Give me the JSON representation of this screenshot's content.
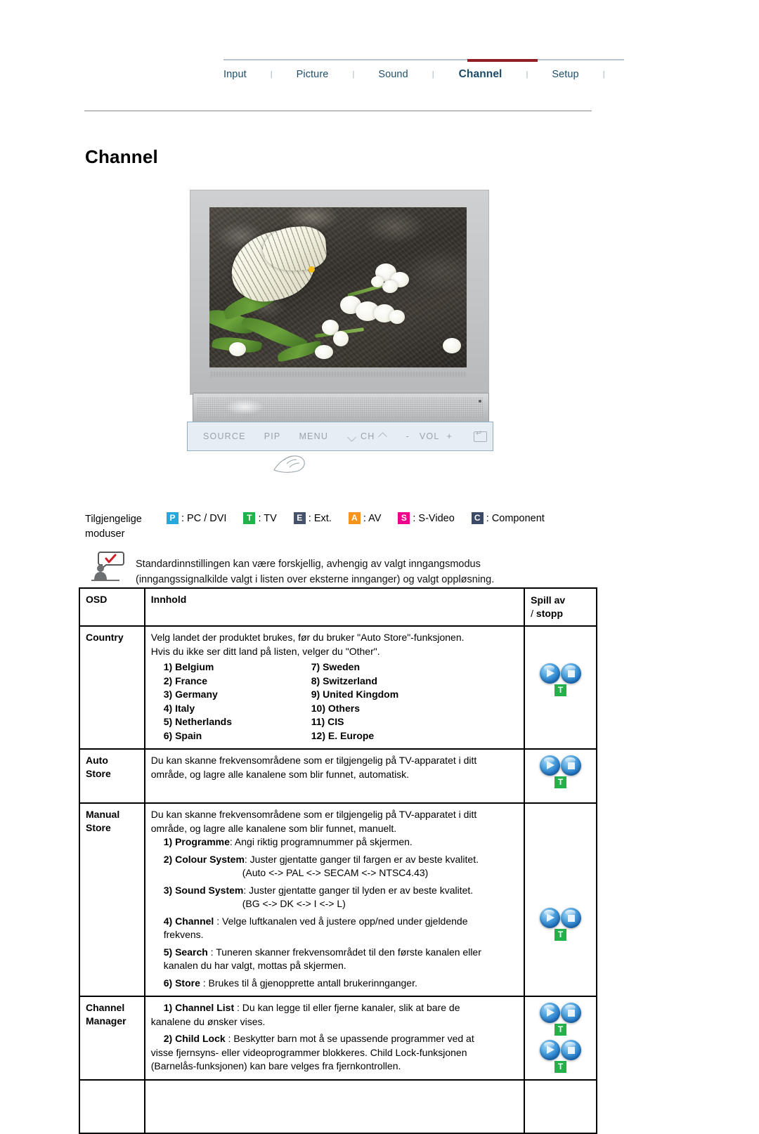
{
  "nav": {
    "tabs": [
      {
        "label": "Input",
        "active": false
      },
      {
        "label": "Picture",
        "active": false
      },
      {
        "label": "Sound",
        "active": false
      },
      {
        "label": "Channel",
        "active": true
      },
      {
        "label": "Setup",
        "active": false
      }
    ],
    "separator": "|",
    "active_color": "#8f1d23"
  },
  "page": {
    "title": "Channel"
  },
  "figure": {
    "controls": [
      {
        "name": "source",
        "label": "SOURCE"
      },
      {
        "name": "pip",
        "label": "PIP"
      },
      {
        "name": "menu",
        "label": "MENU"
      },
      {
        "name": "channel",
        "label": "CH"
      },
      {
        "name": "volume_minus",
        "label": "-"
      },
      {
        "name": "volume",
        "label": "VOL"
      },
      {
        "name": "volume_plus",
        "label": "+"
      }
    ]
  },
  "modes": {
    "lead_line1": "Tilgjengelige",
    "lead_line2": "moduser",
    "items": [
      {
        "badge": "P",
        "text": ": PC / DVI",
        "color": "#23a9e0"
      },
      {
        "badge": "T",
        "text": ": TV",
        "color": "#23b14c"
      },
      {
        "badge": "E",
        "text": ": Ext.",
        "color": "#46516b"
      },
      {
        "badge": "A",
        "text": ": AV",
        "color": "#f7941e"
      },
      {
        "badge": "S",
        "text": ": S-Video",
        "color": "#ec008c"
      },
      {
        "badge": "C",
        "text": ": Component",
        "color": "#3a4a67"
      }
    ]
  },
  "note": {
    "line1": "Standardinnstillingen kan være forskjellig, avhengig av valgt inngangsmodus",
    "line2": "(inngangssignalkilde valgt i listen over eksterne innganger) og valgt oppløsning."
  },
  "table": {
    "headers": {
      "osd": "OSD",
      "innhold": "Innhold",
      "spill_line1": "Spill av",
      "spill_line2_prefix": "/ ",
      "spill_line2": "stopp"
    },
    "rows": [
      {
        "osd": "Country",
        "osd_line2": "",
        "intro": [
          "Velg landet der produktet brukes, før du bruker \"Auto Store\"-funksjonen.",
          "Hvis du ikke ser ditt land på listen, velger du \"Other\"."
        ],
        "countries_left": [
          "1) Belgium",
          "2) France",
          "3) Germany",
          "4) Italy",
          "5) Netherlands",
          "6) Spain"
        ],
        "countries_right": [
          "7) Sweden",
          "8) Switzerland",
          "9) United Kingdom",
          "10) Others",
          "11) CIS",
          "12) E. Europe"
        ],
        "icon_groups": 1,
        "icon_badge": "T"
      },
      {
        "osd": "Auto",
        "osd_line2": "Store",
        "intro": [
          "Du kan skanne frekvensområdene som er tilgjengelig på TV-apparatet i ditt",
          "område, og lagre alle kanalene som blir funnet, automatisk."
        ],
        "icon_groups": 1,
        "icon_badge": "T"
      },
      {
        "osd": "Manual",
        "osd_line2": "Store",
        "intro": [
          "Du kan skanne frekvensområdene som er tilgjengelig på TV-apparatet i ditt",
          "område, og lagre alle kanalene som blir funnet, manuelt."
        ],
        "items": [
          {
            "num": "1) ",
            "bold": "Programme",
            "rest": ": Angi riktig programnummer på skjermen.",
            "sub": ""
          },
          {
            "num": "2) ",
            "bold": "Colour System",
            "rest": ": Juster gjentatte ganger til fargen er av beste kvalitet.",
            "sub": "(Auto <-> PAL <-> SECAM <-> NTSC4.43)"
          },
          {
            "num": "3) ",
            "bold": "Sound System",
            "rest": ": Juster gjentatte ganger til lyden er av beste kvalitet.",
            "sub": "(BG <-> DK <-> I <-> L)"
          },
          {
            "num": "4) ",
            "bold": "Channel",
            "rest": " : Velge luftkanalen ved å justere opp/ned under gjeldende",
            "sub2": "frekvens."
          },
          {
            "num": "5) ",
            "bold": "Search",
            "rest": " : Tuneren skanner frekvensområdet til den første kanalen eller",
            "sub2": "kanalen du har valgt, mottas på skjermen."
          },
          {
            "num": "6) ",
            "bold": "Store",
            "rest": " : Brukes til å gjenopprette antall brukerinnganger.",
            "sub": ""
          }
        ],
        "icon_groups": 1,
        "icon_badge": "T"
      },
      {
        "osd": "Channel",
        "osd_line2": "Manager",
        "items": [
          {
            "num": "1) ",
            "bold": "Channel List",
            "rest": " : Du kan legge til eller fjerne kanaler, slik at bare de",
            "sub2": "kanalene du ønsker vises."
          },
          {
            "num": "2) ",
            "bold": "Child Lock",
            "rest": " : Beskytter barn mot å se upassende programmer ved at",
            "sub2": "visse fjernsyns- eller videoprogrammer blokkeres. Child Lock-funksjonen",
            "sub3": "(Barnelås-funksjonen) kan bare velges fra fjernkontrollen."
          }
        ],
        "icon_groups": 2,
        "icon_badge": "T"
      }
    ]
  }
}
